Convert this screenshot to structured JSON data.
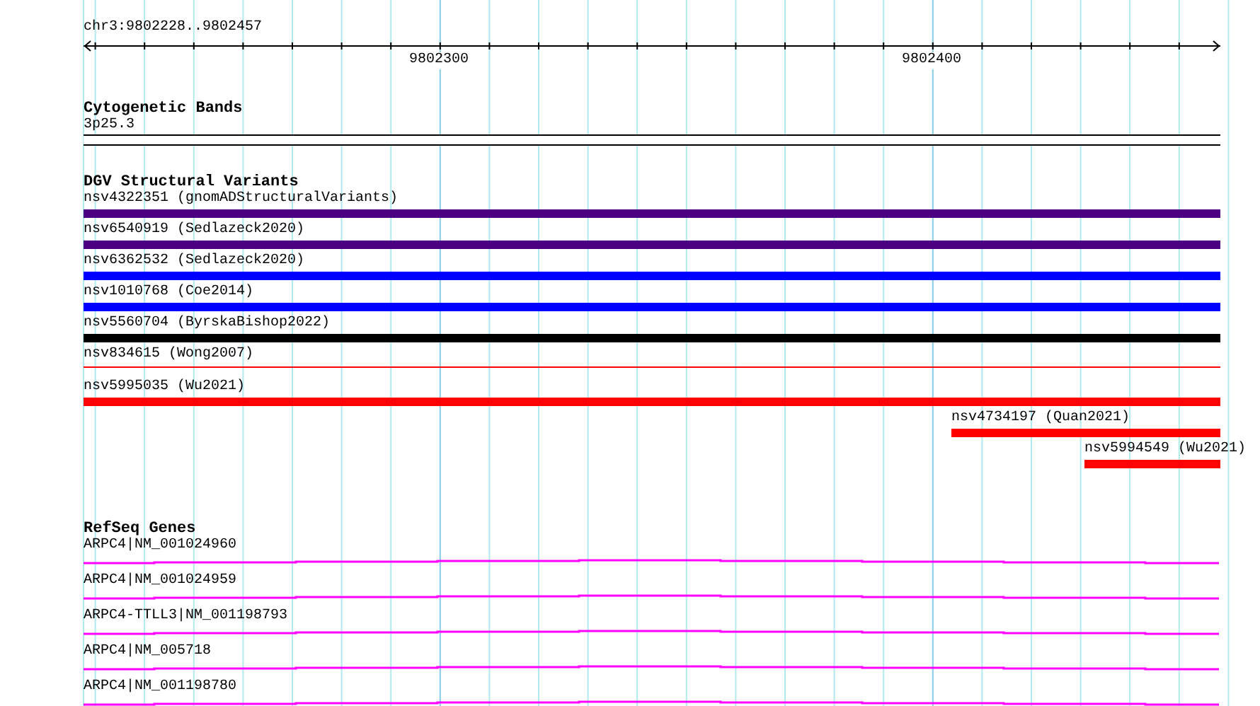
{
  "ruler": {
    "region": "chr3:9802228..9802457",
    "tick_labels": [
      "9802300",
      "9802400"
    ]
  },
  "tracks": [
    {
      "title": "Cytogenetic Bands",
      "kind": "bands",
      "features": [
        {
          "label": "3p25.3"
        }
      ]
    },
    {
      "title": "DGV Structural Variants",
      "kind": "variants",
      "features": [
        {
          "label": "nsv4322351 (gnomADStructuralVariants)",
          "color": "#4b0082",
          "kind": "bar"
        },
        {
          "label": "nsv6540919 (Sedlazeck2020)",
          "color": "#4b0082",
          "kind": "bar"
        },
        {
          "label": "nsv6362532 (Sedlazeck2020)",
          "color": "#0000ff",
          "kind": "bar"
        },
        {
          "label": "nsv1010768 (Coe2014)",
          "color": "#0000ff",
          "kind": "bar"
        },
        {
          "label": "nsv5560704 (ByrskaBishop2022)",
          "color": "#000000",
          "kind": "bar"
        },
        {
          "label": "nsv834615 (Wong2007)",
          "color": "#ff0000",
          "kind": "line"
        },
        {
          "label": "nsv5995035 (Wu2021)",
          "color": "#ff0000",
          "kind": "bar"
        },
        {
          "label": "nsv4734197 (Quan2021)",
          "color": "#ff0000",
          "kind": "bar"
        },
        {
          "label": "nsv5994549 (Wu2021)",
          "color": "#ff0000",
          "kind": "bar"
        }
      ]
    },
    {
      "title": "RefSeq Genes",
      "kind": "genes",
      "features": [
        {
          "label": "ARPC4|NM_001024960"
        },
        {
          "label": "ARPC4|NM_001024959"
        },
        {
          "label": "ARPC4-TTLL3|NM_001198793"
        },
        {
          "label": "ARPC4|NM_005718"
        },
        {
          "label": "ARPC4|NM_001198780"
        }
      ]
    }
  ]
}
